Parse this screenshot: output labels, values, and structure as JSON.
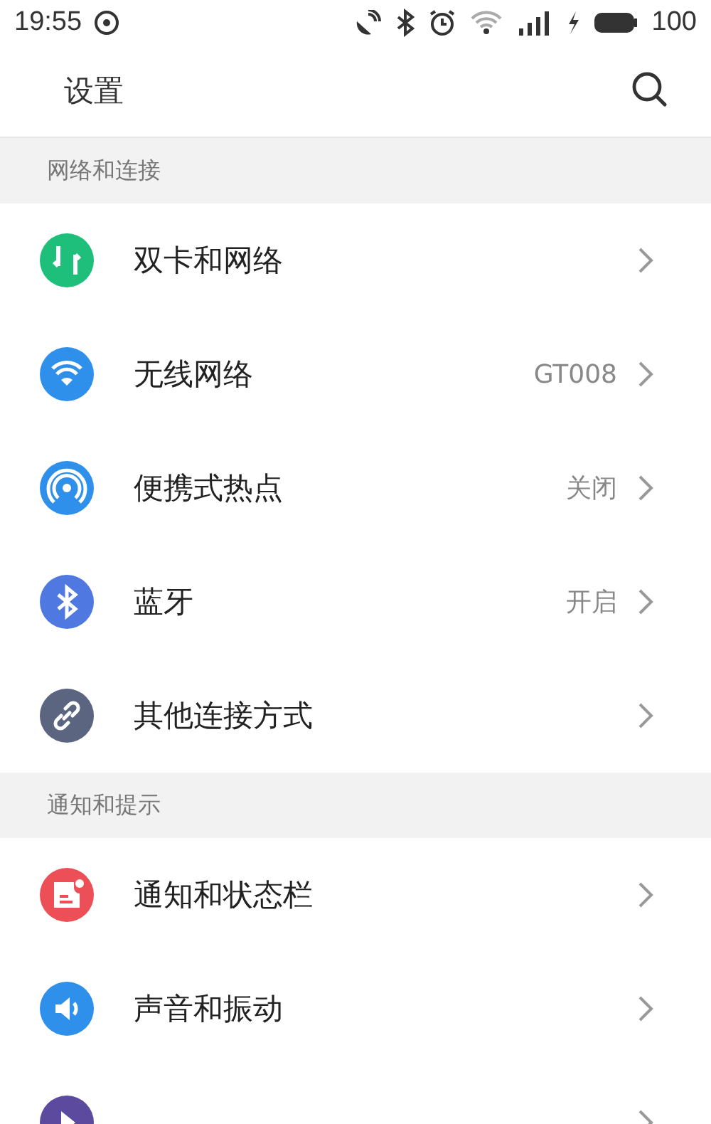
{
  "status_bar": {
    "time": "19:55",
    "battery": "100"
  },
  "header": {
    "title": "设置"
  },
  "sections": [
    {
      "title": "网络和连接",
      "items": [
        {
          "kind": "sim",
          "color": "#1dbf7a",
          "label": "双卡和网络"
        },
        {
          "kind": "wifi",
          "color": "#2e90ea",
          "label": "无线网络",
          "value": "GT008"
        },
        {
          "kind": "hotspot",
          "color": "#2e90ea",
          "label": "便携式热点",
          "value": "关闭"
        },
        {
          "kind": "bluetooth",
          "color": "#4f78e0",
          "label": "蓝牙",
          "value": "开启"
        },
        {
          "kind": "link",
          "color": "#5c6580",
          "label": "其他连接方式"
        }
      ]
    },
    {
      "title": "通知和提示",
      "items": [
        {
          "kind": "notification",
          "color": "#ec4f55",
          "label": "通知和状态栏"
        },
        {
          "kind": "sound",
          "color": "#2e90ea",
          "label": "声音和振动"
        },
        {
          "kind": "note",
          "color": "#5b4a9e"
        }
      ]
    }
  ]
}
